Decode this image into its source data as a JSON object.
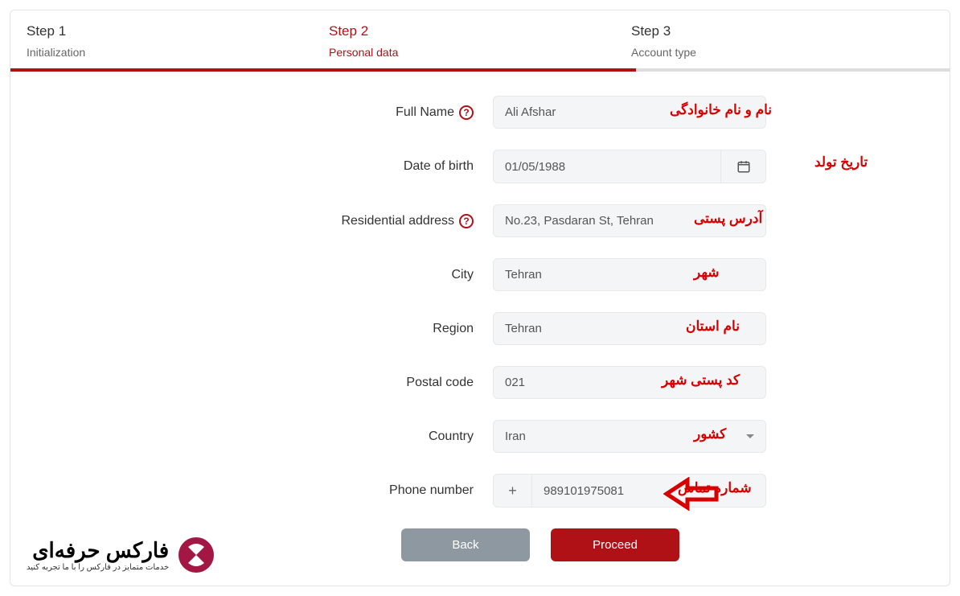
{
  "stepper": {
    "steps": [
      {
        "title": "Step 1",
        "sub": "Initialization"
      },
      {
        "title": "Step 2",
        "sub": "Personal data"
      },
      {
        "title": "Step 3",
        "sub": "Account type"
      }
    ],
    "progress_percent": 66.6
  },
  "form": {
    "full_name": {
      "label": "Full Name",
      "value": "Ali Afshar",
      "annot": "نام و نام خانوادگی"
    },
    "dob": {
      "label": "Date of birth",
      "value": "01/05/1988",
      "annot": "تاریخ تولد"
    },
    "address": {
      "label": "Residential address",
      "value": "No.23, Pasdaran St, Tehran",
      "annot": "آدرس پستی"
    },
    "city": {
      "label": "City",
      "value": "Tehran",
      "annot": "شهر"
    },
    "region": {
      "label": "Region",
      "value": "Tehran",
      "annot": "نام استان"
    },
    "postal": {
      "label": "Postal code",
      "value": "021",
      "annot": "کد پستی شهر"
    },
    "country": {
      "label": "Country",
      "value": "Iran",
      "annot": "کشور"
    },
    "phone": {
      "label": "Phone number",
      "prefix": "+",
      "value": "989101975081",
      "annot": "شماره تماس"
    }
  },
  "buttons": {
    "back": "Back",
    "proceed": "Proceed"
  },
  "logo": {
    "main": "فارکس حرفه‌ای",
    "sub": "خدمات متمایز در فارکس را با ما تجربه کنید"
  }
}
